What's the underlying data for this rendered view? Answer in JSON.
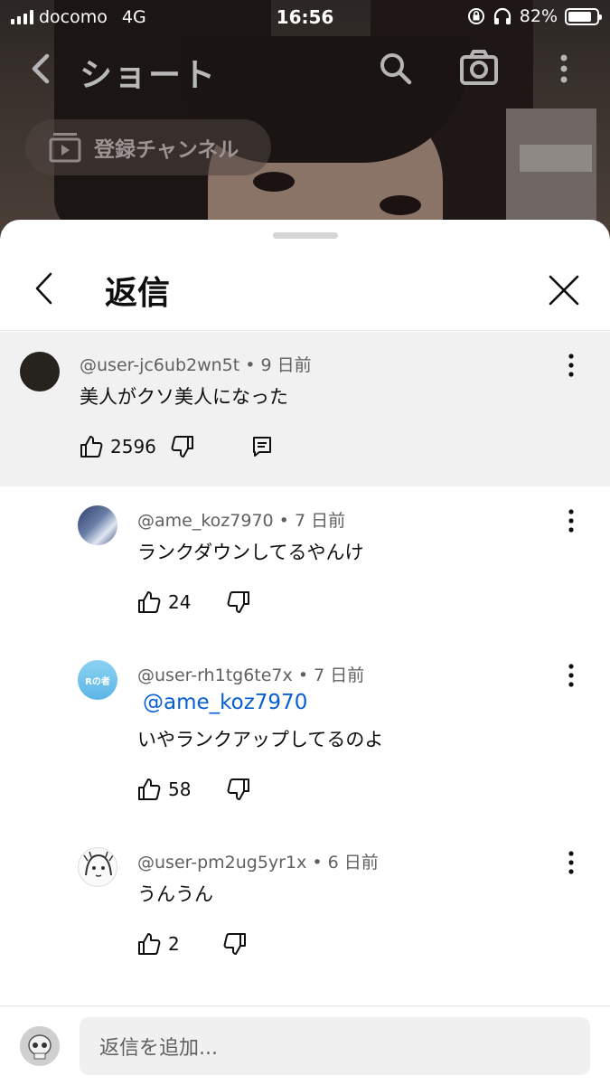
{
  "status_bar": {
    "carrier": "docomo",
    "network": "4G",
    "time": "16:56",
    "battery": "82%",
    "battery_level": 0.82
  },
  "app_bar": {
    "title": "ショート",
    "subscribed_channels": "登録チャンネル"
  },
  "sheet": {
    "title": "返信",
    "parent_comment": {
      "author": "@user-jc6ub2wn5t",
      "age": "9 日前",
      "text": "美人がクソ美人になった",
      "likes": "2596"
    },
    "replies": [
      {
        "author": "@ame_koz7970",
        "age": "7 日前",
        "text": "ランクダウンしてるやんけ",
        "likes": "24"
      },
      {
        "author": "@user-rh1tg6te7x",
        "age": "7 日前",
        "mention": "@ame_koz7970",
        "text": "いやランクアップしてるのよ",
        "likes": "58",
        "avatar_text": "Rの者"
      },
      {
        "author": "@user-pm2ug5yr1x",
        "age": "6 日前",
        "text": "うんうん",
        "likes": "2"
      }
    ],
    "reply_placeholder": "返信を追加..."
  },
  "separator": "•",
  "colors": {
    "link": "#065fd4",
    "highlight_bg": "#f1f1f1",
    "meta_text": "#606060"
  }
}
